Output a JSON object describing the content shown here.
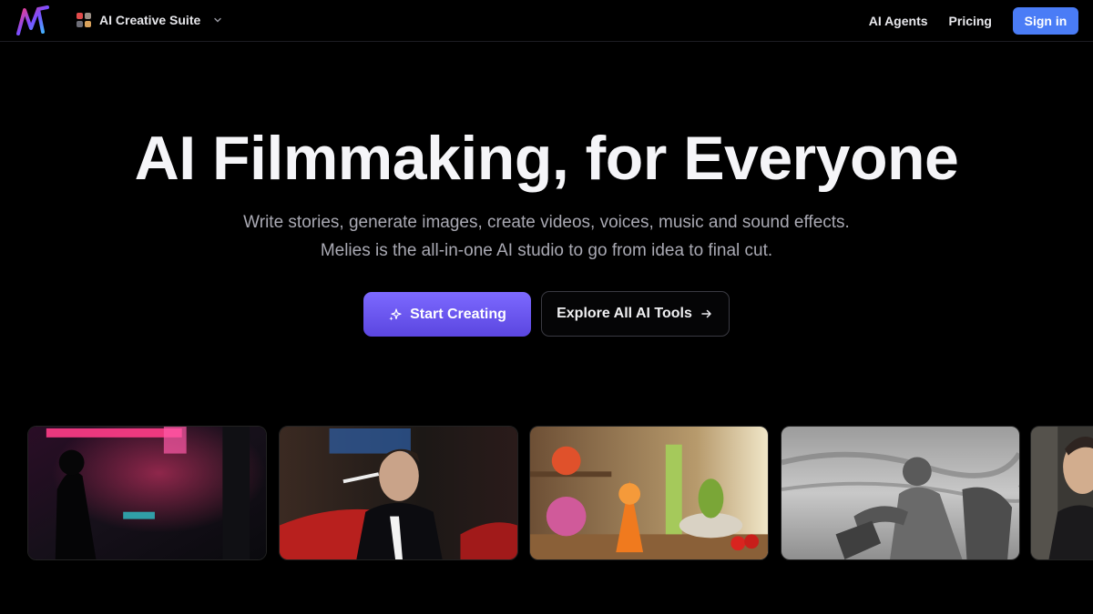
{
  "nav": {
    "suite_label": "AI Creative Suite",
    "links": [
      {
        "label": "AI Agents"
      },
      {
        "label": "Pricing"
      }
    ],
    "signin_label": "Sign in"
  },
  "hero": {
    "headline": "AI Filmmaking, for Everyone",
    "subline1": "Write stories, generate images, create videos, voices, music and sound effects.",
    "subline2": "Melies is the all-in-one AI studio to go from idea to final cut.",
    "primary_cta": "Start Creating",
    "secondary_cta": "Explore All AI Tools"
  },
  "colors": {
    "background": "#000000",
    "primary_gradient_start": "#7c69ff",
    "primary_gradient_end": "#5b46e0",
    "signin": "#4a7cf6"
  },
  "icons": {
    "logo": "melies-logo",
    "suite": "palette-icon",
    "dropdown": "chevron-down-icon",
    "sparkle": "sparkle-icon",
    "arrow": "arrow-right-icon"
  },
  "gallery": {
    "items": [
      {
        "subject": "neon-street-night"
      },
      {
        "subject": "man-smoking-by-car"
      },
      {
        "subject": "animated-vegetables-kitchen"
      },
      {
        "subject": "sketched-fighters"
      },
      {
        "subject": "man-portrait-partial"
      }
    ]
  }
}
